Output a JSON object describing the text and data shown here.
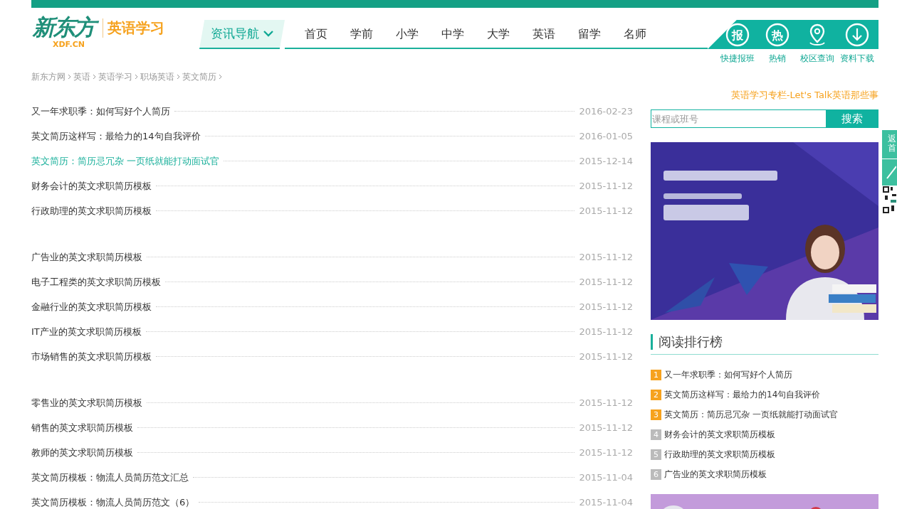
{
  "logo": {
    "brand": "新东方",
    "domain": "XDF.CN",
    "section": "英语学习"
  },
  "nav": {
    "menu_label": "资讯导航",
    "items": [
      {
        "label": "首页"
      },
      {
        "label": "学前"
      },
      {
        "label": "小学"
      },
      {
        "label": "中学"
      },
      {
        "label": "大学"
      },
      {
        "label": "英语"
      },
      {
        "label": "留学"
      },
      {
        "label": "名师"
      }
    ]
  },
  "quick_links": [
    {
      "kind": "bao",
      "glyph": "报",
      "label": "快捷报班"
    },
    {
      "kind": "re",
      "glyph": "热",
      "label": "热销"
    },
    {
      "kind": "location",
      "label": "校区查询"
    },
    {
      "kind": "download",
      "label": "资料下载"
    }
  ],
  "breadcrumb": [
    "新东方网",
    "英语",
    "英语学习",
    "职场英语",
    "英文简历"
  ],
  "article_groups": [
    {
      "articles": [
        {
          "title": "又一年求职季：如何写好个人简历",
          "date": "2016-02-23",
          "highlighted": false
        },
        {
          "title": "英文简历这样写：最给力的14句自我评价",
          "date": "2016-01-05",
          "highlighted": false
        },
        {
          "title": "英文简历：简历忌冗杂 一页纸就能打动面试官",
          "date": "2015-12-14",
          "highlighted": true
        },
        {
          "title": "财务会计的英文求职简历模板",
          "date": "2015-11-12",
          "highlighted": false
        },
        {
          "title": "行政助理的英文求职简历模板",
          "date": "2015-11-12",
          "highlighted": false
        }
      ]
    },
    {
      "articles": [
        {
          "title": "广告业的英文求职简历模板",
          "date": "2015-11-12",
          "highlighted": false
        },
        {
          "title": "电子工程类的英文求职简历模板",
          "date": "2015-11-12",
          "highlighted": false
        },
        {
          "title": "金融行业的英文求职简历模板",
          "date": "2015-11-12",
          "highlighted": false
        },
        {
          "title": "IT产业的英文求职简历模板",
          "date": "2015-11-12",
          "highlighted": false
        },
        {
          "title": "市场销售的英文求职简历模板",
          "date": "2015-11-12",
          "highlighted": false
        }
      ]
    },
    {
      "articles": [
        {
          "title": "零售业的英文求职简历模板",
          "date": "2015-11-12",
          "highlighted": false
        },
        {
          "title": "销售的英文求职简历模板",
          "date": "2015-11-12",
          "highlighted": false
        },
        {
          "title": "教师的英文求职简历模板",
          "date": "2015-11-12",
          "highlighted": false
        },
        {
          "title": "英文简历模板：物流人员简历范文汇总",
          "date": "2015-11-04",
          "highlighted": false
        },
        {
          "title": "英文简历模板：物流人员简历范文（6）",
          "date": "2015-11-04",
          "highlighted": false
        }
      ]
    }
  ],
  "sidebar": {
    "column_link": "英语学习专栏-Let's Talk英语那些事",
    "search": {
      "placeholder": "课程或班号",
      "button": "搜索"
    },
    "ranking": {
      "title": "阅读排行榜",
      "items": [
        {
          "rank": "1",
          "title": "又一年求职季：如何写好个人简历",
          "top": true
        },
        {
          "rank": "2",
          "title": "英文简历这样写：最给力的14句自我评价",
          "top": true
        },
        {
          "rank": "3",
          "title": "英文简历：简历忌冗杂 一页纸就能打动面试官",
          "top": true
        },
        {
          "rank": "4",
          "title": "财务会计的英文求职简历模板",
          "top": false
        },
        {
          "rank": "5",
          "title": "行政助理的英文求职简历模板",
          "top": false
        },
        {
          "rank": "6",
          "title": "广告业的英文求职简历模板",
          "top": false
        }
      ]
    }
  },
  "float_tab": {
    "label": "返首"
  }
}
